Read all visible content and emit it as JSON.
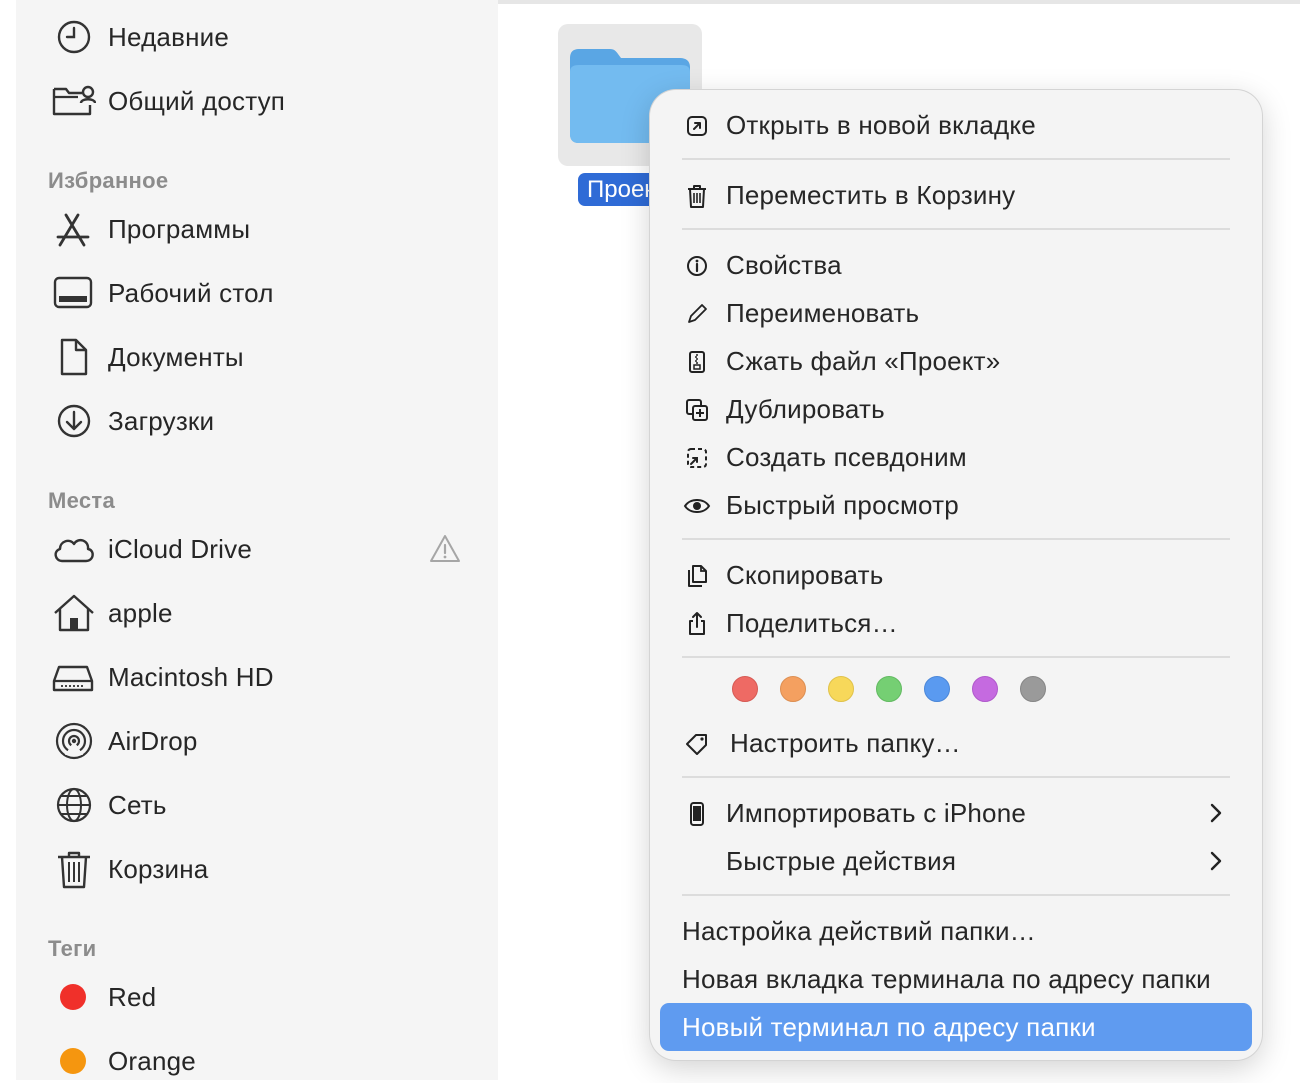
{
  "sidebar": {
    "items_top": [
      {
        "label": "Недавние",
        "icon": "clock-icon"
      },
      {
        "label": "Общий доступ",
        "icon": "shared-folder-icon"
      }
    ],
    "favorites": {
      "title": "Избранное",
      "items": [
        {
          "label": "Программы",
          "icon": "applications-icon"
        },
        {
          "label": "Рабочий стол",
          "icon": "desktop-icon"
        },
        {
          "label": "Документы",
          "icon": "document-icon"
        },
        {
          "label": "Загрузки",
          "icon": "download-icon"
        }
      ]
    },
    "places": {
      "title": "Места",
      "items": [
        {
          "label": "iCloud Drive",
          "icon": "cloud-icon",
          "warning": true
        },
        {
          "label": "apple",
          "icon": "home-icon"
        },
        {
          "label": "Macintosh HD",
          "icon": "hard-drive-icon"
        },
        {
          "label": "AirDrop",
          "icon": "airdrop-icon"
        },
        {
          "label": "Сеть",
          "icon": "globe-icon"
        },
        {
          "label": "Корзина",
          "icon": "trash-icon"
        }
      ]
    },
    "tags": {
      "title": "Теги",
      "items": [
        {
          "label": "Red",
          "color": "#f0302a"
        },
        {
          "label": "Orange",
          "color": "#f5960f"
        }
      ]
    }
  },
  "folder": {
    "label": "Проект",
    "color": "#6fb8ee"
  },
  "context_menu": {
    "open_new_tab": "Открыть в новой вкладке",
    "move_to_trash": "Переместить в Корзину",
    "properties": "Свойства",
    "rename": "Переименовать",
    "compress": "Сжать файл «Проект»",
    "duplicate": "Дублировать",
    "make_alias": "Создать псевдоним",
    "quick_look": "Быстрый просмотр",
    "copy": "Скопировать",
    "share": "Поделиться…",
    "tag_colors": [
      "#ee6a64",
      "#f4a060",
      "#f7d85a",
      "#75cf73",
      "#5a9af0",
      "#c56ae0",
      "#9a9a9a"
    ],
    "customize_folder": "Настроить папку…",
    "import_iphone": "Импортировать с iPhone",
    "quick_actions": "Быстрые действия",
    "folder_actions_setup": "Настройка действий папки…",
    "new_terminal_tab": "Новая вкладка терминала по адресу папки",
    "new_terminal": "Новый терминал по адресу папки"
  }
}
